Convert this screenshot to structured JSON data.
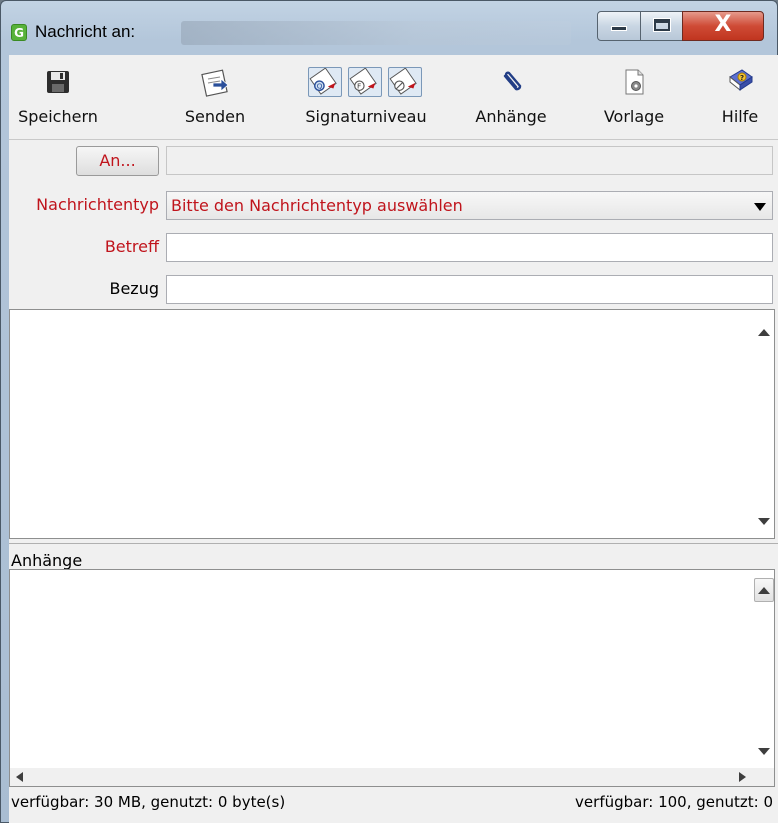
{
  "window": {
    "title": "Nachricht an:",
    "close_glyph": "X"
  },
  "toolbar": {
    "items": [
      {
        "label": "Speichern",
        "icon": "floppy-disk-icon"
      },
      {
        "label": "Senden",
        "icon": "send-message-icon"
      },
      {
        "label": "Signaturniveau",
        "icon": "signature-level-icons"
      },
      {
        "label": "Anhänge",
        "icon": "paperclip-icon"
      },
      {
        "label": "Vorlage",
        "icon": "template-gear-icon"
      },
      {
        "label": "Hilfe",
        "icon": "help-book-icon"
      }
    ],
    "signature_options": [
      "Q",
      "F",
      "⊘"
    ]
  },
  "form": {
    "an_button": "An...",
    "an_value": "",
    "nachrichtentyp_label": "Nachrichtentyp",
    "nachrichtentyp_value": "Bitte den Nachrichtentyp auswählen",
    "betreff_label": "Betreff",
    "betreff_value": "",
    "bezug_label": "Bezug",
    "bezug_value": ""
  },
  "attachments": {
    "title": "Anhänge"
  },
  "status": {
    "left": "verfügbar: 30 MB, genutzt: 0 byte(s)",
    "right": "verfügbar: 100, genutzt: 0"
  },
  "colors": {
    "required_label": "#c0141c",
    "client_background": "#f0f0f0",
    "close_button": "#cf4b36"
  }
}
